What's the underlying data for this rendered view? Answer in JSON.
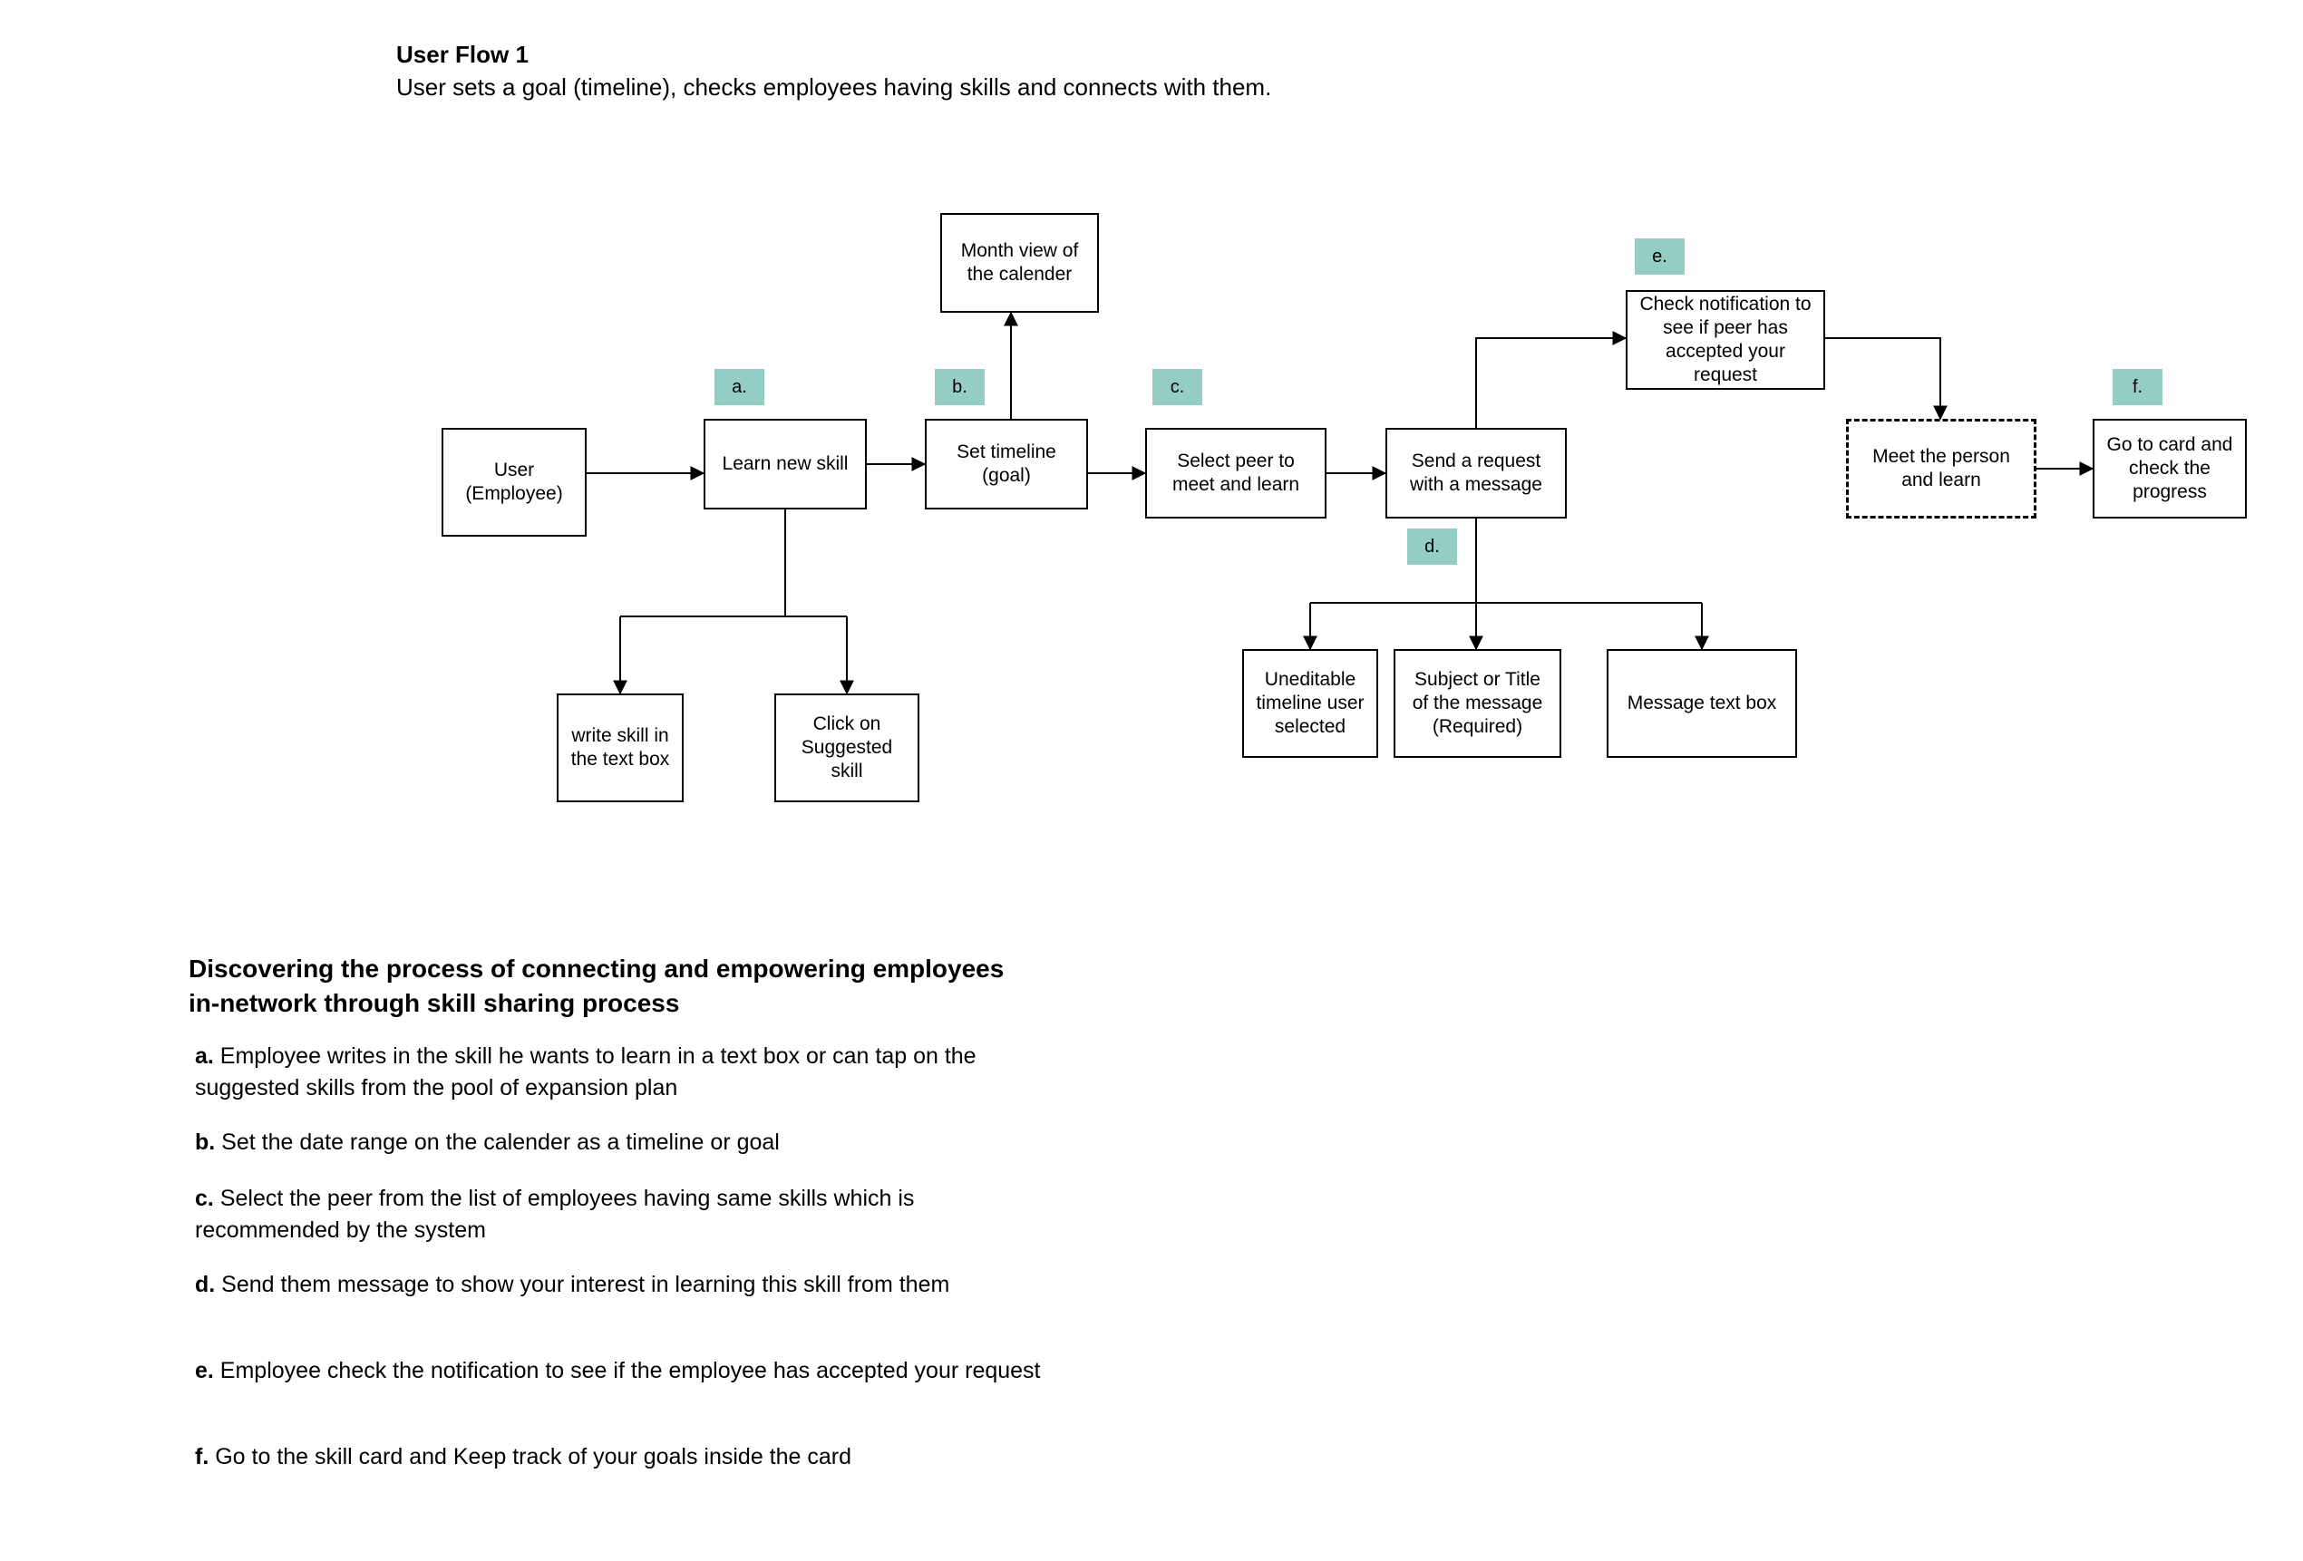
{
  "header": {
    "title": "User Flow 1",
    "subtitle": "User sets a goal (timeline), checks employees having skills and connects with them."
  },
  "tags": {
    "a": "a.",
    "b": "b.",
    "c": "c.",
    "d": "d.",
    "e": "e.",
    "f": "f."
  },
  "nodes": {
    "user": "User (Employee)",
    "learn": "Learn new skill",
    "timeline": "Set timeline (goal)",
    "month": "Month view of the calender",
    "peer": "Select peer to meet and learn",
    "request": "Send a request with a message",
    "notif": "Check notification to see if peer has accepted your request",
    "meet": "Meet the person and learn",
    "card": "Go to card and check the progress",
    "write": "write skill in the text box",
    "suggest": "Click on Suggested skill",
    "uneditable": "Uneditable timeline user selected",
    "subject": "Subject or Title of the message (Required)",
    "msgbox": "Message text box"
  },
  "legend": {
    "heading": "Discovering the process of connecting and empowering employees in-network through skill sharing process",
    "items": {
      "a": {
        "key": "a.",
        "text": " Employee writes in the skill he wants to learn in a text box or can tap on the suggested skills from the pool of expansion plan"
      },
      "b": {
        "key": "b.",
        "text": " Set the date range on the calender as a timeline or goal"
      },
      "c": {
        "key": "c.",
        "text": " Select the peer from the list of employees having same skills which is recommended by the system"
      },
      "d": {
        "key": "d.",
        "text": " Send them message to show your interest in learning this skill from them"
      },
      "e": {
        "key": "e.",
        "text": " Employee check the notification to see if the employee  has accepted your request"
      },
      "f": {
        "key": "f.",
        "text": " Go to the skill card and Keep track of your goals inside the card"
      }
    }
  }
}
